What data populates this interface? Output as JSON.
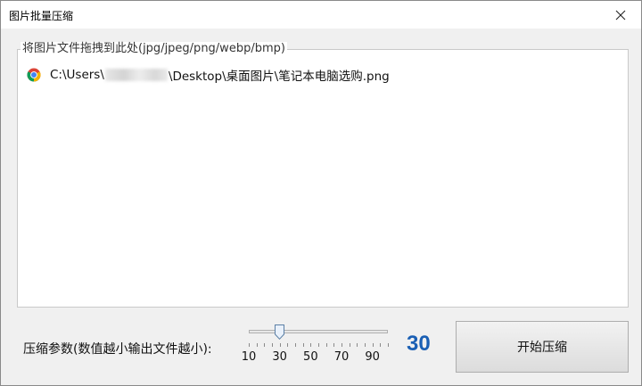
{
  "window": {
    "title": "图片批量压缩",
    "close_icon": "close-icon"
  },
  "dropzone": {
    "legend": "将图片文件拖拽到此处(jpg/jpeg/png/webp/bmp)",
    "files": [
      {
        "icon": "chrome-icon",
        "path_prefix": "C:\\Users\\",
        "path_suffix": "\\Desktop\\桌面图片\\笔记本电脑选购.png"
      }
    ]
  },
  "compression": {
    "label": "压缩参数(数值越小输出文件越小):",
    "slider_min": 10,
    "slider_max": 100,
    "slider_value": 30,
    "tick_labels": [
      "10",
      "30",
      "50",
      "70",
      "90"
    ],
    "value_display": "30"
  },
  "start_button": {
    "label": "开始压缩"
  },
  "colors": {
    "value_accent": "#1a5fb4"
  }
}
